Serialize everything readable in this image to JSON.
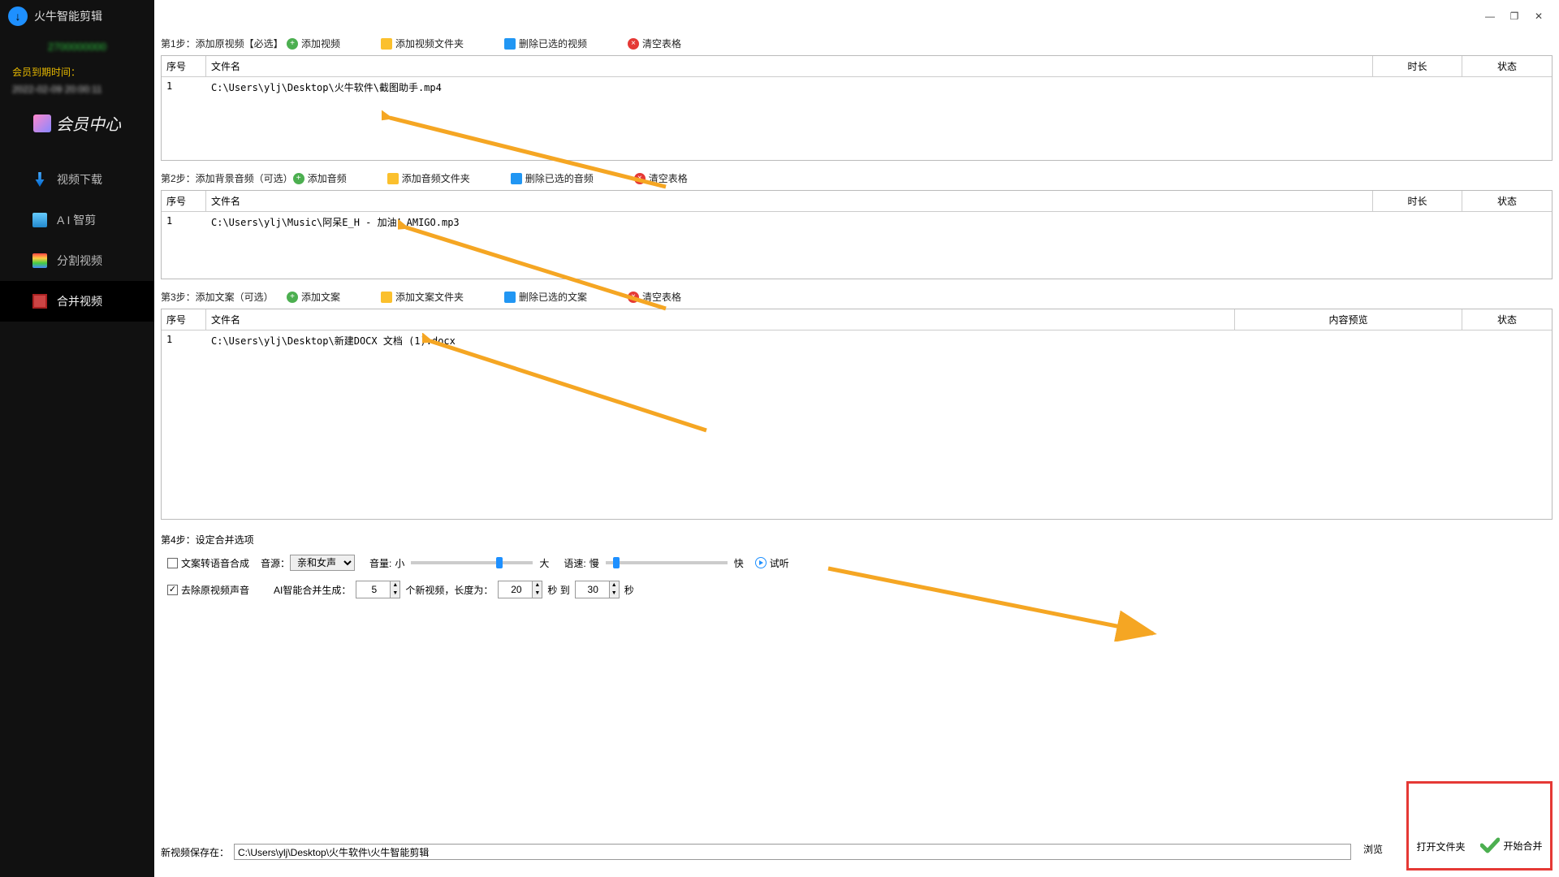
{
  "app": {
    "title": "火牛智能剪辑"
  },
  "window_controls": {
    "min": "—",
    "max": "❐",
    "close": "✕"
  },
  "sidebar": {
    "uid": "2700000000",
    "expire_label": "会员到期时间：",
    "expire_date": "2022-02-09 20:00:11",
    "vip_center": "会员中心",
    "items": [
      {
        "label": "视频下载"
      },
      {
        "label": "A I 智剪"
      },
      {
        "label": "分割视频"
      },
      {
        "label": "合并视频"
      }
    ]
  },
  "step1": {
    "label": "第1步：添加原视频【必选】",
    "add": "添加视频",
    "add_folder": "添加视频文件夹",
    "del_sel": "删除已选的视频",
    "clear": "清空表格",
    "cols": {
      "seq": "序号",
      "name": "文件名",
      "dur": "时长",
      "status": "状态"
    },
    "rows": [
      {
        "seq": "1",
        "name": "C:\\Users\\ylj\\Desktop\\火牛软件\\截图助手.mp4"
      }
    ]
  },
  "step2": {
    "label": "第2步：添加背景音频（可选）",
    "add": "添加音频",
    "add_folder": "添加音频文件夹",
    "del_sel": "删除已选的音频",
    "clear": "清空表格",
    "cols": {
      "seq": "序号",
      "name": "文件名",
      "dur": "时长",
      "status": "状态"
    },
    "rows": [
      {
        "seq": "1",
        "name": "C:\\Users\\ylj\\Music\\阿呆E_H - 加油！AMIGO.mp3"
      }
    ]
  },
  "step3": {
    "label": "第3步：添加文案（可选）",
    "add": "添加文案",
    "add_folder": "添加文案文件夹",
    "del_sel": "删除已选的文案",
    "clear": "清空表格",
    "cols": {
      "seq": "序号",
      "name": "文件名",
      "preview": "内容预览",
      "status": "状态"
    },
    "rows": [
      {
        "seq": "1",
        "name": "C:\\Users\\ylj\\Desktop\\新建DOCX 文档 (1).docx"
      }
    ]
  },
  "step4": {
    "label": "第4步：设定合并选项",
    "tts_checkbox": "文案转语音合成",
    "voice_label": "音源：",
    "voice_value": "亲和女声",
    "volume_label": "音量:",
    "volume_min": "小",
    "volume_max": "大",
    "speed_label": "语速:",
    "speed_min": "慢",
    "speed_max": "快",
    "preview": "试听",
    "mute_original": "去除原视频声音",
    "ai_gen_label": "AI智能合并生成：",
    "ai_gen_count": "5",
    "ai_gen_suffix": "个新视频，长度为：",
    "len_min": "20",
    "len_sec_label": "秒 到",
    "len_max": "30",
    "len_sec": "秒"
  },
  "save": {
    "label": "新视频保存在：",
    "path": "C:\\Users\\ylj\\Desktop\\火牛软件\\火牛智能剪辑",
    "browse": "浏览"
  },
  "actions": {
    "open_folder": "打开文件夹",
    "start": "开始合并"
  }
}
